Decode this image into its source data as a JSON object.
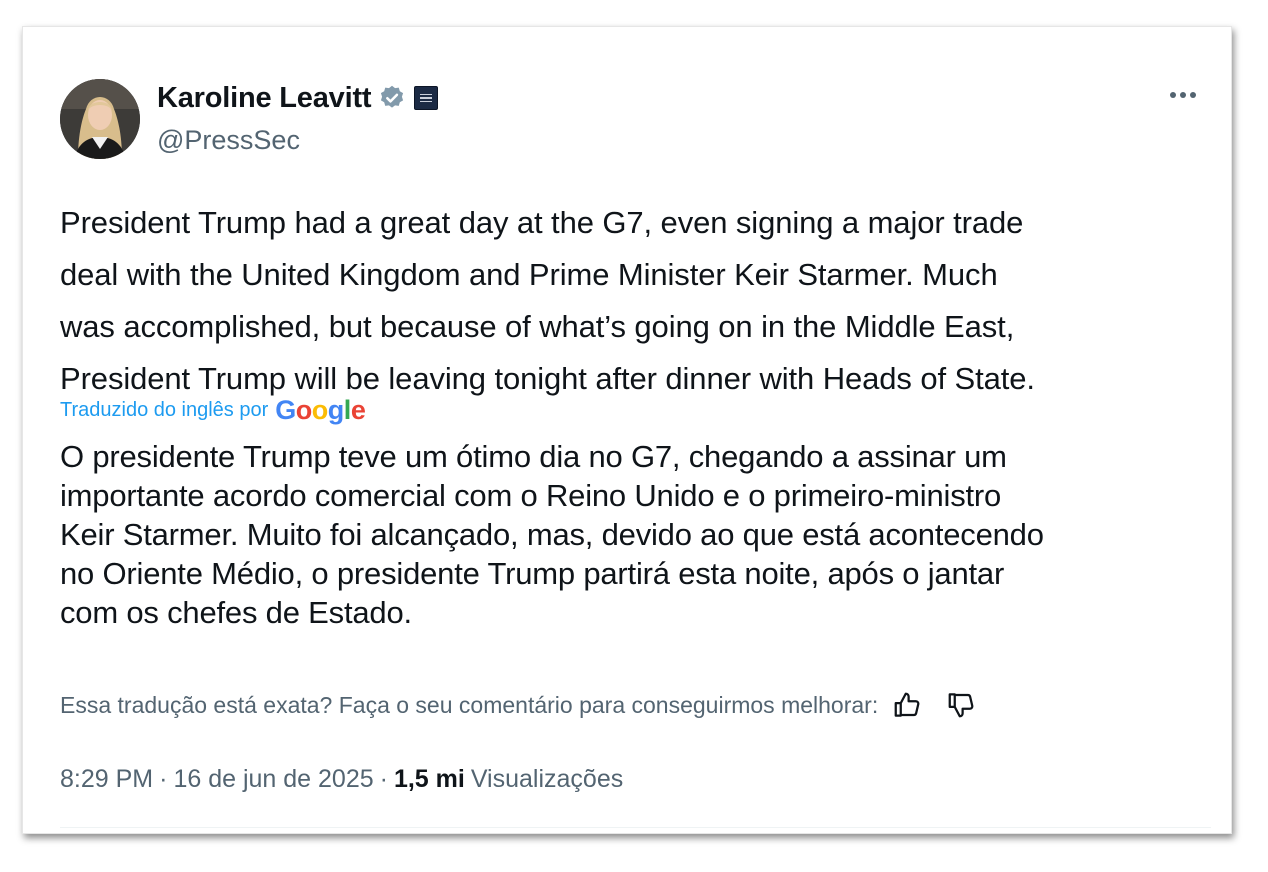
{
  "author": {
    "name": "Karoline Leavitt",
    "handle": "@PressSec",
    "verified_color": "#829aab",
    "affiliate_badge": "white-house-badge"
  },
  "tweet": {
    "lines": [
      "President Trump had a great day at the G7, even signing a major trade",
      "deal with the United Kingdom and Prime Minister Keir Starmer. Much",
      "was accomplished, but because of what’s going on in the Middle East,",
      "President Trump will be leaving tonight after dinner with Heads of State."
    ]
  },
  "translation": {
    "label": "Traduzido do inglês por",
    "provider": {
      "g1": "G",
      "o1": "o",
      "o2": "o",
      "g2": "g",
      "l": "l",
      "e": "e"
    },
    "lines": [
      "O presidente Trump teve um ótimo dia no G7, chegando a assinar um",
      "importante acordo comercial com o Reino Unido e o primeiro-ministro",
      "Keir Starmer. Muito foi alcançado, mas, devido ao que está acontecendo",
      "no Oriente Médio, o presidente Trump partirá esta noite, após o jantar",
      "com os chefes de Estado."
    ],
    "feedback_prompt": "Essa tradução está exata? Faça o seu comentário para conseguirmos melhorar:"
  },
  "meta": {
    "time": "8:29 PM",
    "separator": "·",
    "date": "16 de jun de 2025",
    "views_count": "1,5 mi",
    "views_label": "Visualizações"
  },
  "colors": {
    "text_primary": "#0f1419",
    "text_secondary": "#536471",
    "link_blue": "#1d9bf0"
  },
  "icons": {
    "more": "more-horizontal-icon",
    "thumbs_up": "thumbs-up-icon",
    "thumbs_down": "thumbs-down-icon",
    "verified": "verified-badge-icon"
  }
}
